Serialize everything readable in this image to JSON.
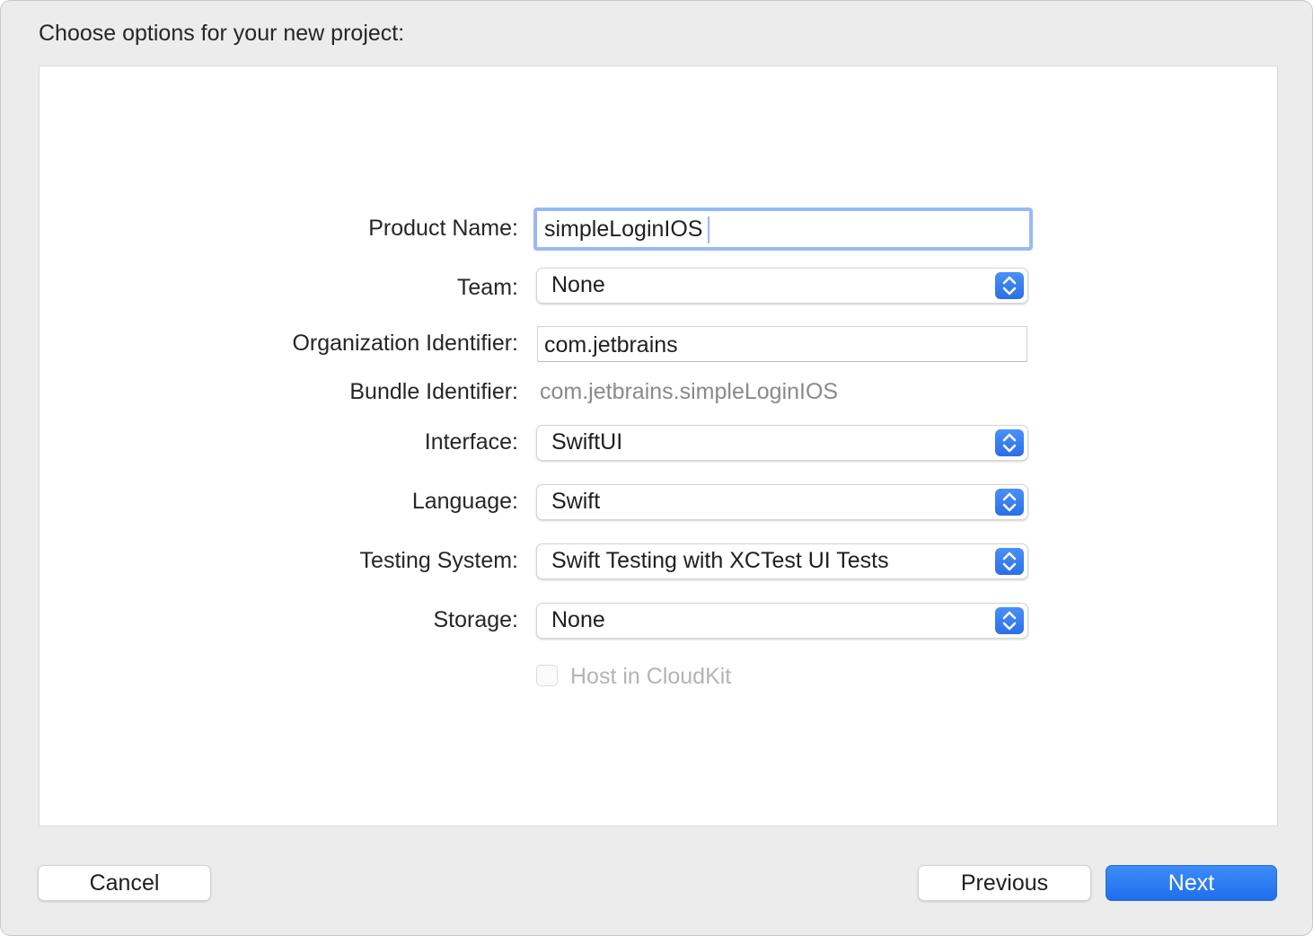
{
  "dialog": {
    "heading": "Choose options for your new project:"
  },
  "form": {
    "product_name": {
      "label": "Product Name:",
      "value": "simpleLoginIOS"
    },
    "team": {
      "label": "Team:",
      "value": "None"
    },
    "organization_identifier": {
      "label": "Organization Identifier:",
      "value": "com.jetbrains"
    },
    "bundle_identifier": {
      "label": "Bundle Identifier:",
      "value": "com.jetbrains.simpleLoginIOS"
    },
    "interface": {
      "label": "Interface:",
      "value": "SwiftUI"
    },
    "language": {
      "label": "Language:",
      "value": "Swift"
    },
    "testing_system": {
      "label": "Testing System:",
      "value": "Swift Testing with XCTest UI Tests"
    },
    "storage": {
      "label": "Storage:",
      "value": "None"
    },
    "host_in_cloudkit": {
      "label": "Host in CloudKit",
      "checked": false,
      "enabled": false
    }
  },
  "footer": {
    "cancel_label": "Cancel",
    "previous_label": "Previous",
    "next_label": "Next"
  },
  "colors": {
    "accent": "#2a6fe8",
    "focus_ring": "#9ab8f5",
    "dialog_background": "#ececec",
    "disabled_text": "#b4b4b4"
  },
  "icons": {
    "popup_stepper": "chevron-up-down-icon"
  }
}
